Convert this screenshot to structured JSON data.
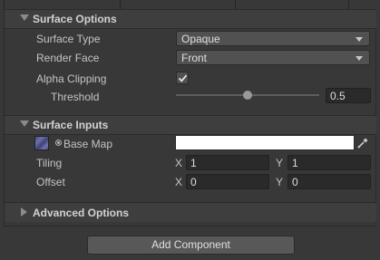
{
  "surface_options": {
    "title": "Surface Options",
    "surface_type": {
      "label": "Surface Type",
      "value": "Opaque"
    },
    "render_face": {
      "label": "Render Face",
      "value": "Front"
    },
    "alpha_clipping": {
      "label": "Alpha Clipping",
      "checked": true
    },
    "threshold": {
      "label": "Threshold",
      "value": "0.5",
      "fraction": 0.5
    }
  },
  "surface_inputs": {
    "title": "Surface Inputs",
    "base_map": {
      "label": "Base Map",
      "color": "#ffffff"
    },
    "tiling": {
      "label": "Tiling",
      "x_label": "X",
      "x": "1",
      "y_label": "Y",
      "y": "1"
    },
    "offset": {
      "label": "Offset",
      "x_label": "X",
      "x": "0",
      "y_label": "Y",
      "y": "0"
    }
  },
  "advanced_options": {
    "title": "Advanced Options"
  },
  "footer": {
    "add_component_label": "Add Component"
  }
}
